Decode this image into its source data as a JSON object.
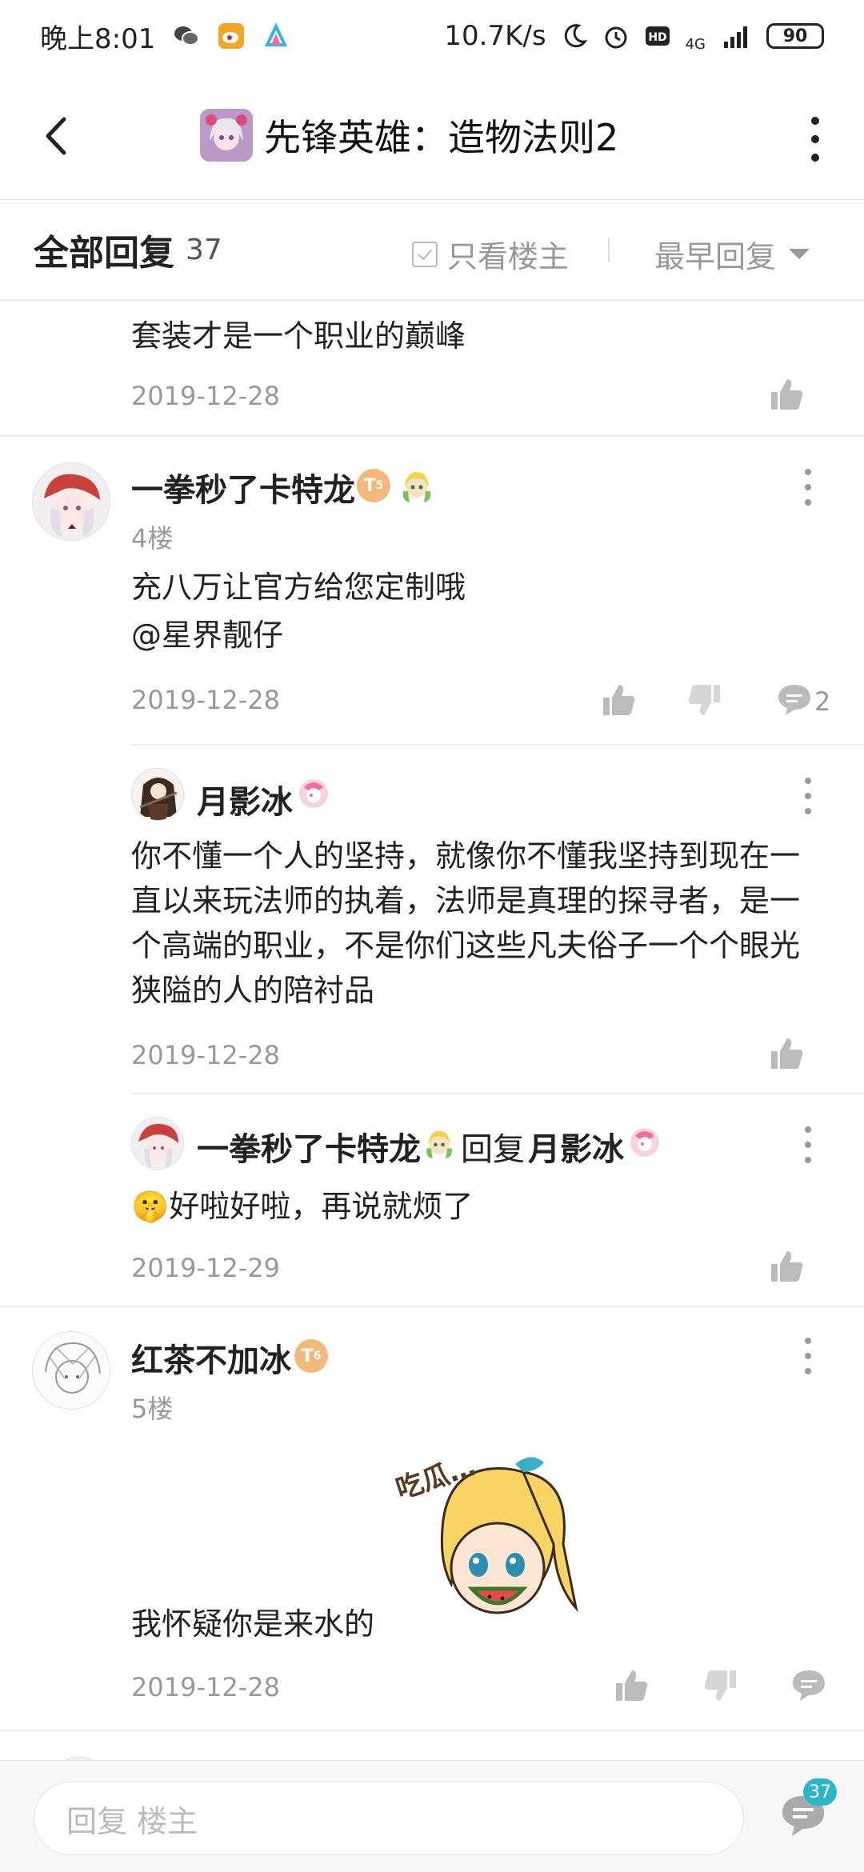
{
  "status_bar": {
    "time": "晚上8:01",
    "net_speed": "10.7K/s",
    "network": "4G",
    "battery": "90"
  },
  "header": {
    "title": "先锋英雄：造物法则2"
  },
  "replies_bar": {
    "title": "全部回复",
    "count": "37",
    "only_host": "只看楼主",
    "sort": "最早回复"
  },
  "posts": {
    "prev": {
      "text": "套装才是一个职业的巅峰",
      "date": "2019-12-28"
    },
    "floor4": {
      "user": "一拳秒了卡特龙",
      "badge": "T",
      "badge_level": "5",
      "floor": "4楼",
      "text1": "充八万让官方给您定制哦",
      "text2": "@星界靓仔",
      "date": "2019-12-28",
      "comment_count": "2",
      "sub1": {
        "user": "月影冰",
        "text": "你不懂一个人的坚持，就像你不懂我坚持到现在一直以来玩法师的执着，法师是真理的探寻者，是一个高端的职业，不是你们这些凡夫俗子一个个眼光狭隘的人的陪衬品",
        "date": "2019-12-28"
      },
      "sub2": {
        "user": "一拳秒了卡特龙",
        "reply_word": "回复",
        "reply_to": "月影冰",
        "emoji": "🤫",
        "text": "好啦好啦，再说就烦了",
        "date": "2019-12-29"
      }
    },
    "floor5": {
      "user": "红茶不加冰",
      "badge": "T",
      "badge_level": "6",
      "floor": "5楼",
      "text": "我怀疑你是来水的",
      "sticker_text": "吃瓜…",
      "date": "2019-12-28"
    }
  },
  "bottom_bar": {
    "placeholder": "回复  楼主",
    "comment_count": "37"
  }
}
